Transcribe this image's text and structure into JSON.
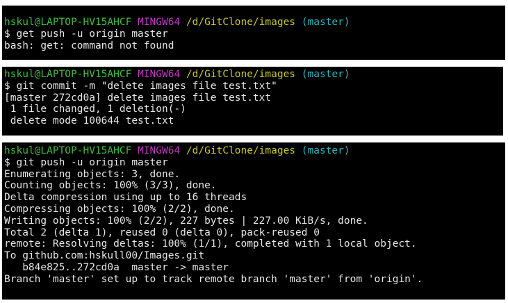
{
  "panels": [
    {
      "prompt": {
        "user": "hskul@LAPTOP-HV15AHCF",
        "env": "MINGW64",
        "path": "/d/GitClone/images",
        "branch": "(master)"
      },
      "lines": [
        "$ get push -u origin master",
        "bash: get: command not found"
      ]
    },
    {
      "prompt": {
        "user": "hskul@LAPTOP-HV15AHCF",
        "env": "MINGW64",
        "path": "/d/GitClone/images",
        "branch": "(master)"
      },
      "lines": [
        "$ git commit -m \"delete images file test.txt\"",
        "[master 272cd0a] delete images file test.txt",
        " 1 file changed, 1 deletion(-)",
        " delete mode 100644 test.txt"
      ]
    },
    {
      "prompt": {
        "user": "hskul@LAPTOP-HV15AHCF",
        "env": "MINGW64",
        "path": "/d/GitClone/images",
        "branch": "(master)"
      },
      "lines": [
        "$ git push -u origin master",
        "Enumerating objects: 3, done.",
        "Counting objects: 100% (3/3), done.",
        "Delta compression using up to 16 threads",
        "Compressing objects: 100% (2/2), done.",
        "Writing objects: 100% (2/2), 227 bytes | 227.00 KiB/s, done.",
        "Total 2 (delta 1), reused 0 (delta 0), pack-reused 0",
        "remote: Resolving deltas: 100% (1/1), completed with 1 local object.",
        "To github.com:hskull00/Images.git",
        "   b84e825..272cd0a  master -> master",
        "Branch 'master' set up to track remote branch 'master' from 'origin'."
      ]
    }
  ]
}
